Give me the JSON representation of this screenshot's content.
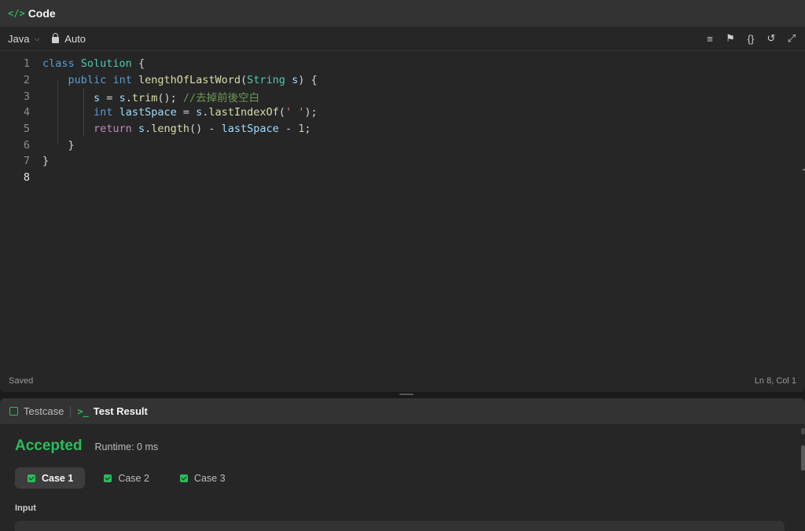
{
  "header": {
    "icon": "code-brackets-icon",
    "title": "Code"
  },
  "toolbar": {
    "language": "Java",
    "mode": "Auto",
    "tools": [
      "format-icon",
      "bookmark-icon",
      "braces-icon",
      "reset-icon",
      "expand-icon"
    ]
  },
  "editor": {
    "lines": [
      {
        "n": "1"
      },
      {
        "n": "2"
      },
      {
        "n": "3"
      },
      {
        "n": "4"
      },
      {
        "n": "5"
      },
      {
        "n": "6"
      },
      {
        "n": "7"
      },
      {
        "n": "8"
      }
    ],
    "tokens": {
      "l1_class": "class",
      "l1_name": "Solution",
      "l1_brace": " {",
      "l2_public": "public",
      "l2_int": "int",
      "l2_method": "lengthOfLastWord",
      "l2_open": "(",
      "l2_type": "String",
      "l2_param": "s",
      "l2_close": ") {",
      "l3_s": "s",
      "l3_eq": " = ",
      "l3_s2": "s",
      "l3_dot": ".",
      "l3_trim": "trim",
      "l3_rest": "(); ",
      "l3_comment": "//去掉前後空白",
      "l4_int": "int",
      "l4_var": "lastSpace",
      "l4_eq": " = ",
      "l4_s": "s",
      "l4_dot": ".",
      "l4_fn": "lastIndexOf",
      "l4_open": "(",
      "l4_str": "' '",
      "l4_close": ");",
      "l5_return": "return",
      "l5_s": "s",
      "l5_dot": ".",
      "l5_fn": "length",
      "l5_mid": "() - ",
      "l5_var": "lastSpace",
      "l5_minus": " - ",
      "l5_num": "1",
      "l5_end": ";",
      "l6_brace": "}",
      "l7_brace": "}"
    }
  },
  "status": {
    "saved": "Saved",
    "position": "Ln 8, Col 1"
  },
  "bottom": {
    "tab_testcase": "Testcase",
    "tab_result": "Test Result",
    "accepted": "Accepted",
    "runtime": "Runtime: 0 ms",
    "cases": [
      "Case 1",
      "Case 2",
      "Case 3"
    ],
    "input_label": "Input"
  },
  "colors": {
    "accent": "#2cbb5d",
    "background": "#262626"
  }
}
